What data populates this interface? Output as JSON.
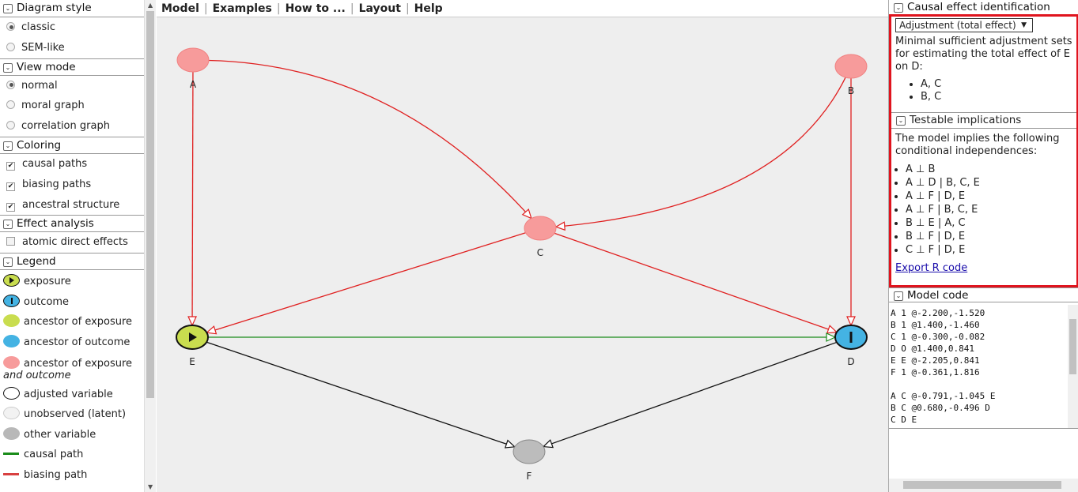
{
  "left_panel": {
    "diagram_style": {
      "title": "Diagram style",
      "options": [
        {
          "label": "classic",
          "selected": true
        },
        {
          "label": "SEM-like",
          "selected": false
        }
      ]
    },
    "view_mode": {
      "title": "View mode",
      "options": [
        {
          "label": "normal",
          "selected": true
        },
        {
          "label": "moral graph",
          "selected": false
        },
        {
          "label": "correlation graph",
          "selected": false
        }
      ]
    },
    "coloring": {
      "title": "Coloring",
      "options": [
        {
          "label": "causal paths",
          "checked": true
        },
        {
          "label": "biasing paths",
          "checked": true
        },
        {
          "label": "ancestral structure",
          "checked": true
        }
      ]
    },
    "effect_analysis": {
      "title": "Effect analysis",
      "options": [
        {
          "label": "atomic direct effects",
          "checked": false
        }
      ]
    },
    "legend": {
      "title": "Legend",
      "items": [
        {
          "label": "exposure",
          "color": "#c9dd4f",
          "icon": "play-icon"
        },
        {
          "label": "outcome",
          "color": "#44b3e3",
          "icon": "bar-icon"
        },
        {
          "label": "ancestor of exposure",
          "color": "#c9dd4f"
        },
        {
          "label": "ancestor of outcome",
          "color": "#44b3e3"
        },
        {
          "label": "ancestor of exposure",
          "label2": "and outcome",
          "color": "#f39a9a"
        },
        {
          "label": "adjusted variable",
          "color": "#ffffff"
        },
        {
          "label": "unobserved (latent)",
          "color": "#eeeeee"
        },
        {
          "label": "other variable",
          "color": "#b8b8b8"
        },
        {
          "label": "causal path",
          "color": "#1a8c1a"
        },
        {
          "label": "biasing path",
          "color": "#d84040"
        }
      ]
    }
  },
  "menu": {
    "items": [
      "Model",
      "Examples",
      "How to ...",
      "Layout",
      "Help"
    ]
  },
  "graph": {
    "nodes": [
      {
        "id": "A",
        "role": "ancestor-exposure-outcome",
        "color": "#f79b9b"
      },
      {
        "id": "B",
        "role": "ancestor-exposure-outcome",
        "color": "#f79b9b"
      },
      {
        "id": "C",
        "role": "ancestor-exposure-outcome",
        "color": "#f79b9b"
      },
      {
        "id": "D",
        "role": "outcome",
        "color": "#44b3e3"
      },
      {
        "id": "E",
        "role": "exposure",
        "color": "#c9dd4f"
      },
      {
        "id": "F",
        "role": "other",
        "color": "#bcbcbc"
      }
    ],
    "edges": [
      {
        "from": "A",
        "to": "C",
        "type": "biasing",
        "color": "#e02020"
      },
      {
        "from": "A",
        "to": "E",
        "type": "biasing",
        "color": "#e02020"
      },
      {
        "from": "B",
        "to": "C",
        "type": "biasing",
        "color": "#e02020"
      },
      {
        "from": "B",
        "to": "D",
        "type": "biasing",
        "color": "#e02020"
      },
      {
        "from": "C",
        "to": "E",
        "type": "biasing",
        "color": "#e02020"
      },
      {
        "from": "C",
        "to": "D",
        "type": "biasing",
        "color": "#e02020"
      },
      {
        "from": "E",
        "to": "D",
        "type": "causal",
        "color": "#1a8c1a"
      },
      {
        "from": "E",
        "to": "F",
        "type": "other",
        "color": "#111111"
      },
      {
        "from": "D",
        "to": "F",
        "type": "other",
        "color": "#111111"
      }
    ]
  },
  "right_panel": {
    "causal_effect": {
      "title": "Causal effect identification",
      "select_value": "Adjustment (total effect)",
      "description": "Minimal sufficient adjustment sets for estimating the total effect of E on D:",
      "sets": [
        "A, C",
        "B, C"
      ]
    },
    "testable": {
      "title": "Testable implications",
      "description": "The model implies the following conditional independences:",
      "implications": [
        "A ⊥ B",
        "A ⊥ D | B, C, E",
        "A ⊥ F | D, E",
        "A ⊥ F | B, C, E",
        "B ⊥ E | A, C",
        "B ⊥ F | D, E",
        "C ⊥ F | D, E"
      ],
      "export_link": "Export R code"
    },
    "model_code": {
      "title": "Model code",
      "lines": [
        "A 1 @-2.200,-1.520",
        "B 1 @1.400,-1.460",
        "C 1 @-0.300,-0.082",
        "D O @1.400,0.841",
        "E E @-2.205,0.841",
        "F 1 @-0.361,1.816",
        "",
        "A C @-0.791,-1.045 E",
        "B C @0.680,-0.496 D",
        "C D E"
      ]
    }
  }
}
